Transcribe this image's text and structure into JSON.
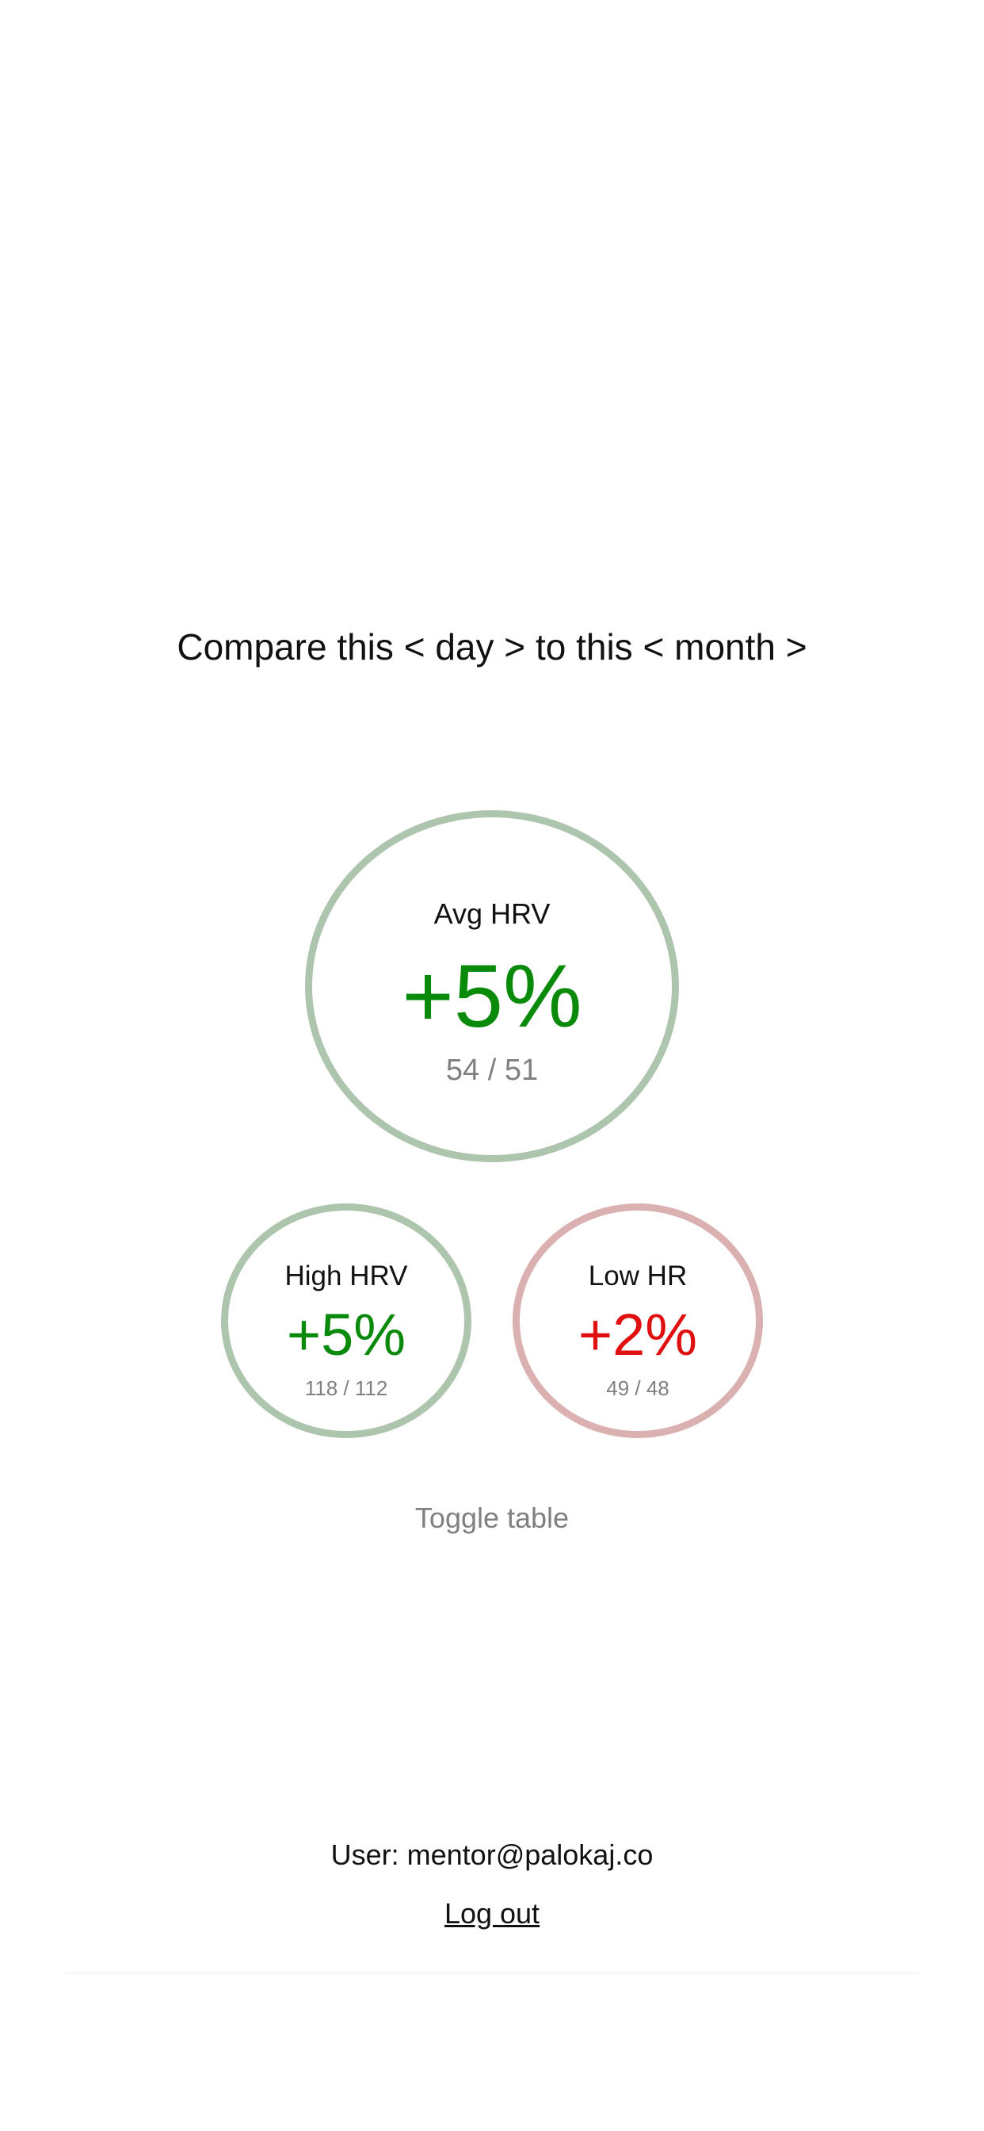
{
  "compare": {
    "prefix": "Compare this",
    "left_open": "<",
    "period_a": "day",
    "left_close": ">",
    "middle": "to this",
    "right_open": "<",
    "period_b": "month",
    "right_close": ">"
  },
  "metrics": {
    "avg_hrv": {
      "label": "Avg HRV",
      "change": "+5%",
      "detail": "54 / 51",
      "ring_color": "#adc5ad",
      "value_color": "#0a8a0a"
    },
    "high_hrv": {
      "label": "High HRV",
      "change": "+5%",
      "detail": "118 / 112",
      "ring_color": "#adc5ad",
      "value_color": "#0a8a0a"
    },
    "low_hr": {
      "label": "Low HR",
      "change": "+2%",
      "detail": "49 / 48",
      "ring_color": "#dbb0b0",
      "value_color": "#e01010"
    }
  },
  "toggle_table_label": "Toggle table",
  "user": {
    "text": "User: mentor@palokaj.co"
  },
  "logout_label": "Log out"
}
